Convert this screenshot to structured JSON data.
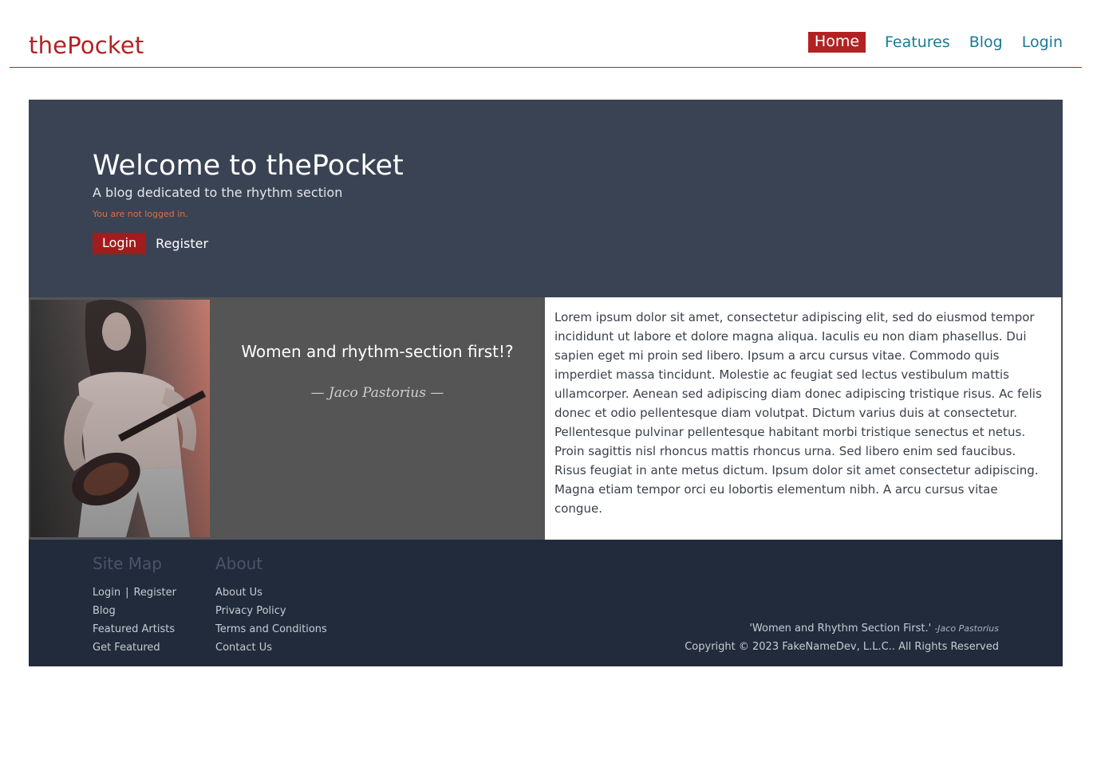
{
  "header": {
    "brand": "thePocket",
    "nav": [
      "Home",
      "Features",
      "Blog",
      "Login"
    ]
  },
  "hero": {
    "title": "Welcome to thePocket",
    "subtitle": "A blog dedicated to the rhythm section",
    "status": "You are not logged in.",
    "login_label": "Login",
    "register_label": "Register"
  },
  "feature": {
    "quote": "Women and rhythm-section first!?",
    "author": "— Jaco Pastorius —",
    "body": "Lorem ipsum dolor sit amet, consectetur adipiscing elit, sed do eiusmod tempor incididunt ut labore et dolore magna aliqua. Iaculis eu non diam phasellus. Dui sapien eget mi proin sed libero. Ipsum a arcu cursus vitae. Commodo quis imperdiet massa tincidunt. Molestie ac feugiat sed lectus vestibulum mattis ullamcorper. Aenean sed adipiscing diam donec adipiscing tristique risus. Ac felis donec et odio pellentesque diam volutpat. Dictum varius duis at consectetur. Pellentesque pulvinar pellentesque habitant morbi tristique senectus et netus. Proin sagittis nisl rhoncus mattis rhoncus urna. Sed libero enim sed faucibus. Risus feugiat in ante metus dictum. Ipsum dolor sit amet consectetur adipiscing. Magna etiam tempor orci eu lobortis elementum nibh. A arcu cursus vitae congue."
  },
  "footer": {
    "sitemap_title": "Site Map",
    "sitemap": {
      "login": "Login",
      "separator": "|",
      "register": "Register",
      "blog": "Blog",
      "featured": "Featured Artists",
      "get_featured": "Get Featured"
    },
    "about_title": "About",
    "about": [
      "About Us",
      "Privacy Policy",
      "Terms and Conditions",
      "Contact Us"
    ],
    "quote": "'Women and Rhythm Section First.'",
    "quote_author": "-Jaco Pastorius",
    "copyright": "Copyright © 2023 FakeNameDev, L.L.C.. All Rights Reserved"
  },
  "colors": {
    "accent": "#b22222",
    "link": "#1a7a96",
    "hero_bg": "#3a4354",
    "band_bg": "#555555",
    "footer_bg": "#222b3b"
  }
}
